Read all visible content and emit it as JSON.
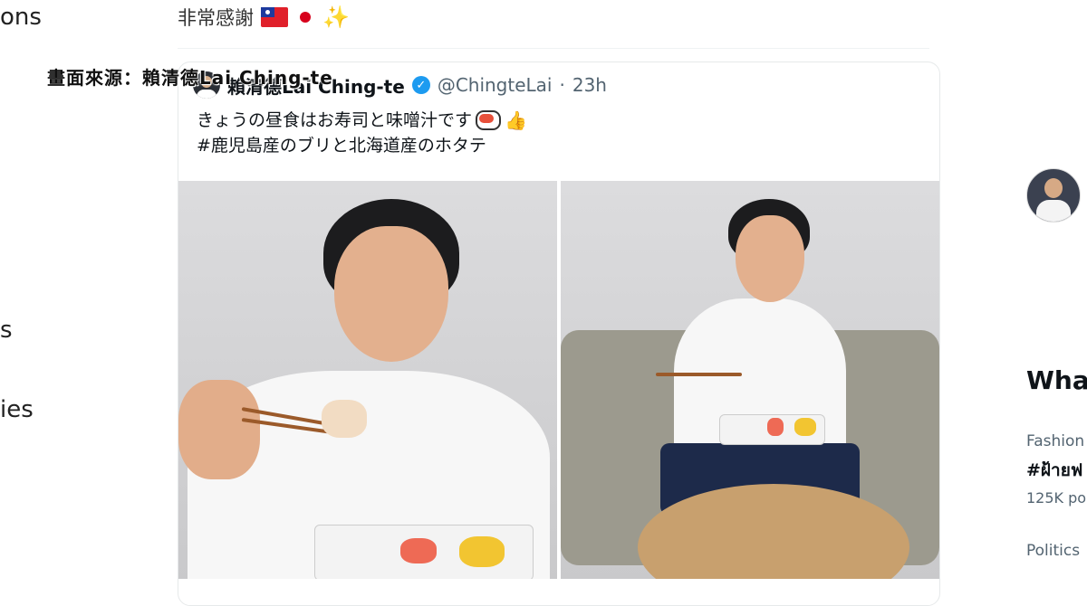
{
  "nav": {
    "item1": "ons",
    "item2": "s",
    "item3": "ies"
  },
  "post": {
    "text": "非常感謝"
  },
  "quoted": {
    "name": "賴清德Lai Ching-te",
    "handle": "@ChingteLai",
    "separator": "·",
    "time": "23h",
    "line1": "きょうの昼食はお寿司と味噌汁です",
    "line2": "#鹿児島産のブリと北海道産のホタテ"
  },
  "caption": "畫面來源：賴清德Lai Ching-te",
  "sidebar": {
    "title": "What",
    "trend1_category": "Fashion",
    "trend1_name": "#ฝ้ายฟ",
    "trend1_count": "125K po",
    "trend2_category": "Politics"
  },
  "colors": {
    "verified": "#1d9bf0",
    "text_secondary": "#536471"
  }
}
